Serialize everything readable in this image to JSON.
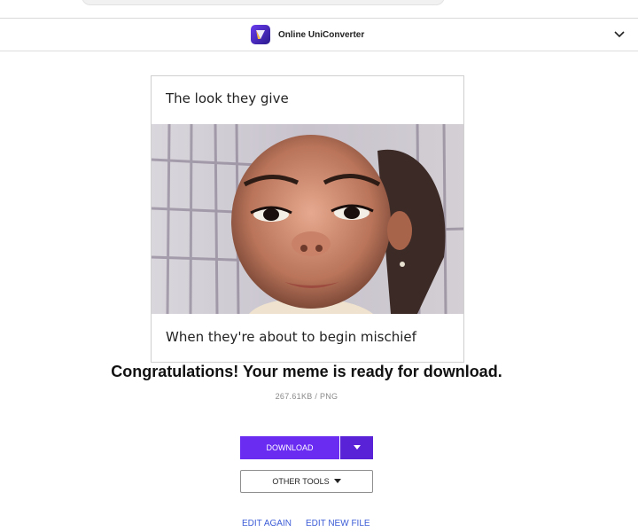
{
  "header": {
    "brand_name": "Online UniConverter",
    "icons": {
      "logo": "uniconverter-logo-icon",
      "menu": "chevron-down-icon"
    }
  },
  "meme": {
    "top_text": "The look they give",
    "bottom_text": "When they're about to begin mischief"
  },
  "result": {
    "title": "Congratulations! Your meme is ready for download.",
    "file_info": "267.61KB / PNG"
  },
  "actions": {
    "download_label": "DOWNLOAD",
    "other_tools_label": "OTHER TOOLS",
    "edit_again_label": "EDIT AGAIN",
    "edit_new_file_label": "EDIT NEW FILE"
  },
  "colors": {
    "accent": "#6b2cf2",
    "link": "#3b5bd6"
  }
}
